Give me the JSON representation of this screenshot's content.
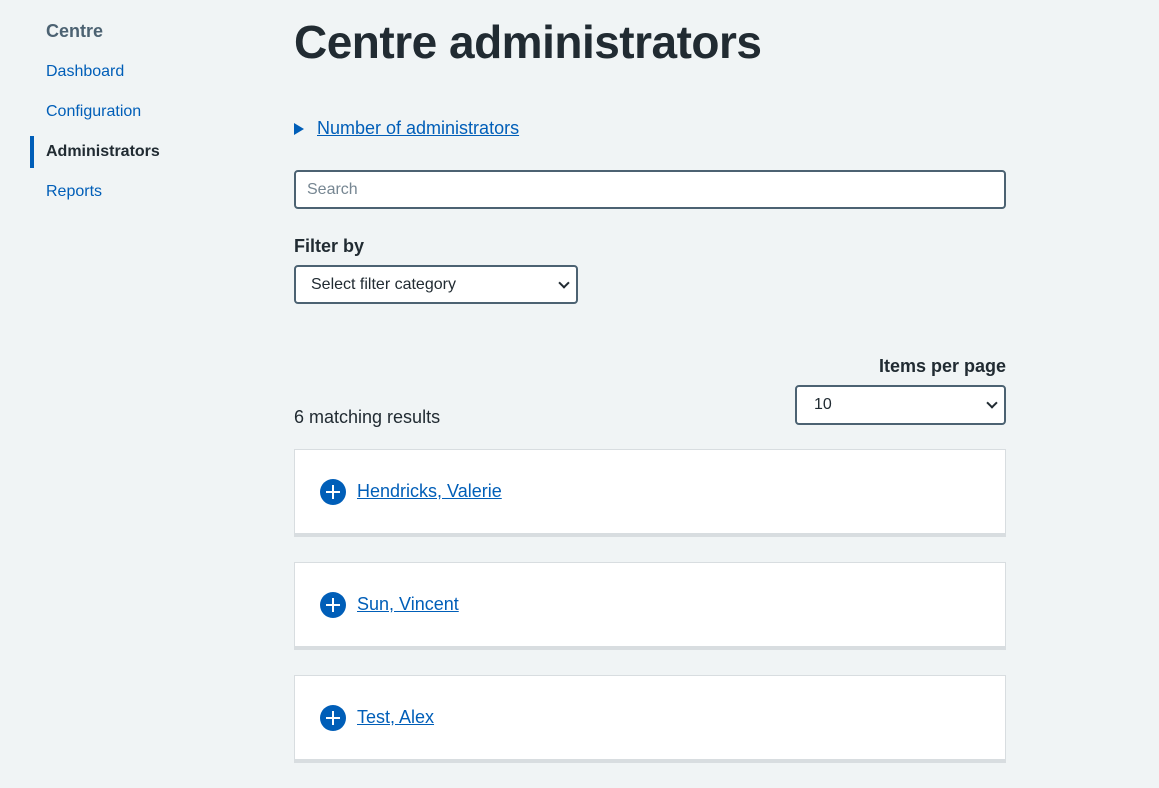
{
  "sidebar": {
    "title": "Centre",
    "items": [
      {
        "label": "Dashboard",
        "active": false
      },
      {
        "label": "Configuration",
        "active": false
      },
      {
        "label": "Administrators",
        "active": true
      },
      {
        "label": "Reports",
        "active": false
      }
    ]
  },
  "main": {
    "title": "Centre administrators",
    "details_summary": "Number of administrators",
    "search": {
      "placeholder": "Search",
      "value": ""
    },
    "filter": {
      "label": "Filter by",
      "selected": "Select filter category"
    },
    "items_per_page": {
      "label": "Items per page",
      "selected": "10"
    },
    "results_text": "6 matching results",
    "administrators": [
      {
        "name": "Hendricks, Valerie"
      },
      {
        "name": "Sun, Vincent"
      },
      {
        "name": "Test, Alex"
      }
    ]
  },
  "colors": {
    "accent": "#005eb8",
    "background": "#f0f4f5",
    "text": "#212b32",
    "border": "#4c6272"
  }
}
